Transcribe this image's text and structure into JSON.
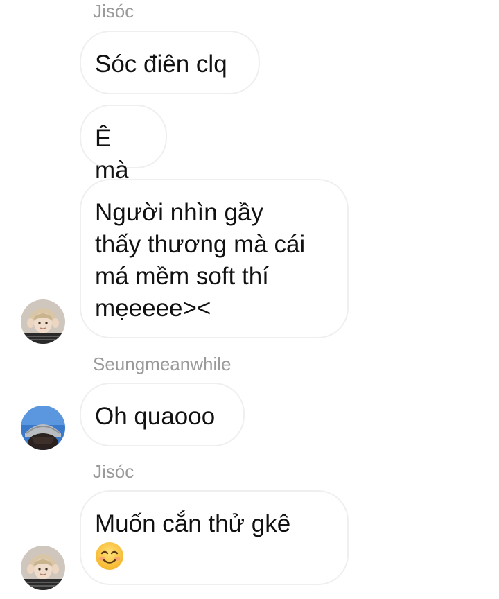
{
  "messages": [
    {
      "sender": "Jisóc"
    },
    {
      "text": "Sóc điên clq"
    },
    {
      "text": "Ê mà"
    },
    {
      "text": "Người nhìn gầy\nthấy thương mà cái\nmá mềm soft thí\nmẹeeee><"
    },
    {
      "sender": "Seungmeanwhile"
    },
    {
      "text": "Oh quaooo"
    },
    {
      "sender": "Jisóc"
    },
    {
      "text": "Muốn cắn thử gkê",
      "emoji": "smiling-face-with-smiling-eyes"
    }
  ],
  "avatars": {
    "jisoc": "avatar-jisoc",
    "seungmeanwhile": "avatar-seungmeanwhile"
  }
}
